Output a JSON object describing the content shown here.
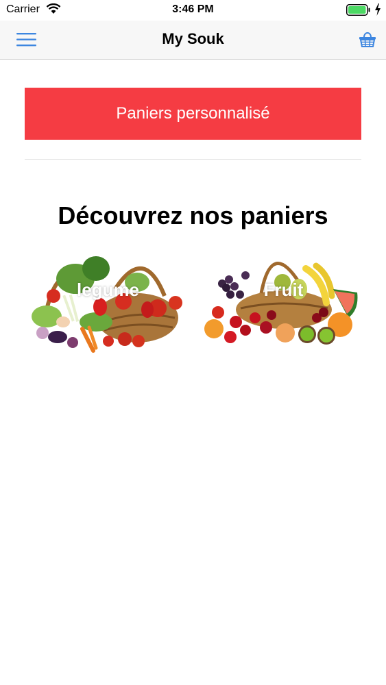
{
  "status_bar": {
    "carrier": "Carrier",
    "time": "3:46 PM",
    "wifi_icon": "wifi-icon",
    "battery_icon": "battery-charging-icon"
  },
  "nav": {
    "title": "My Souk",
    "menu_icon": "hamburger-menu-icon",
    "cart_icon": "basket-icon"
  },
  "custom_basket_button": "Paniers personnalisé",
  "section_title": "Découvrez nos paniers",
  "baskets": [
    {
      "label": "legume",
      "image_icon": "vegetable-basket-image"
    },
    {
      "label": "Fruit",
      "image_icon": "fruit-basket-image"
    }
  ],
  "colors": {
    "accent_red": "#f53c43",
    "ios_blue": "#3d86e0",
    "nav_bg": "#f7f7f7",
    "battery_green": "#4cd964"
  }
}
